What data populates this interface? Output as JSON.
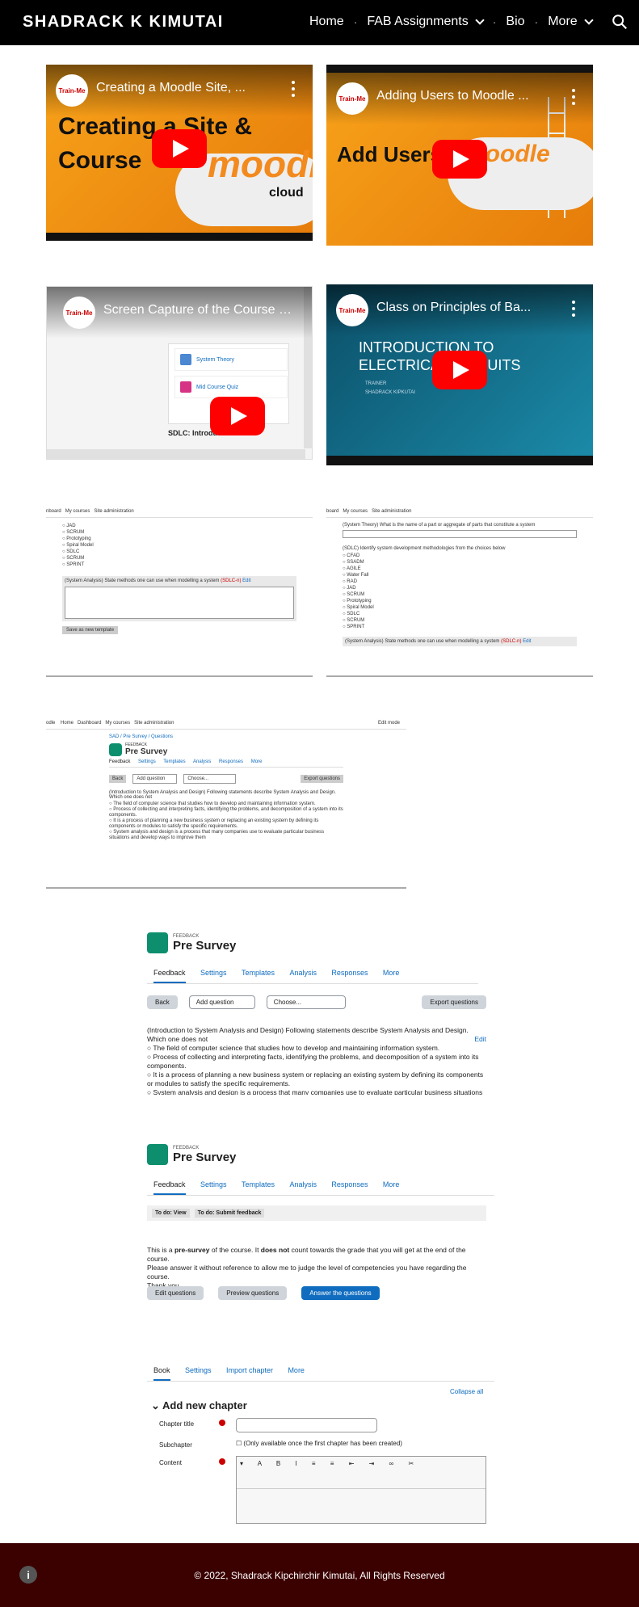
{
  "site": {
    "title": "SHADRACK K KIMUTAI"
  },
  "nav": {
    "items": [
      "Home",
      "FAB Assignments",
      "Bio",
      "More"
    ]
  },
  "videos": [
    {
      "title": "Creating a Moodle Site, ...",
      "overlay1": "Creating a Site &",
      "overlay2": "Course",
      "brand": "moodle",
      "sub": "cloud",
      "channel": "Train-Me"
    },
    {
      "title": "Adding Users to Moodle ...",
      "overlay1": "Add Users",
      "brand": "moodle",
      "channel": "Train-Me"
    },
    {
      "title": "Screen Capture of the Course b...",
      "items": [
        "System Theory",
        "Mid Course Quiz",
        "SDLC: Introduction and"
      ],
      "channel": "Train-Me"
    },
    {
      "title": "Class on Principles of Ba...",
      "line1": "INTRODUCTION TO",
      "line2": "ELECTRICAL CIRCUITS",
      "trainer": "TRAINER",
      "name": "SHADRACK KIPKUTAI",
      "channel": "Train-Me"
    }
  ],
  "shot1": {
    "nav": [
      "nboard",
      "My courses",
      "Site administration"
    ],
    "options": [
      "JAD",
      "SCRUM",
      "Prototyping",
      "Spiral Model",
      "SDLC",
      "SCRUM",
      "SPRINT"
    ],
    "question": "(System Analysis) State methods one can use when modelling a system",
    "tag": "(SDLC-n)",
    "edit": "Edit",
    "button": "Save as new template"
  },
  "shot2": {
    "nav": [
      "board",
      "My courses",
      "Site administration"
    ],
    "q1": "(System Theory) What is the name of a part or aggregate of parts that constitute a system",
    "q2": "(SDLC) Identify system development methodologies from the choices below",
    "options": [
      "CFAD",
      "SSADM",
      "AGILE",
      "Water Fall",
      "RAD",
      "JAD",
      "SCRUM",
      "Prototyping",
      "Spiral Model",
      "SDLC",
      "SCRUM",
      "SPRINT"
    ],
    "q3": "(System Analysis) State methods one can use when modelling a system",
    "tag": "(SDLC-n)",
    "edit": "Edit"
  },
  "shot3": {
    "nav": [
      "odle",
      "Home",
      "Dashboard",
      "My courses",
      "Site administration"
    ],
    "edit_mode": "Edit mode",
    "breadcrumb": "SAD / Pre Survey / Questions",
    "label": "FEEDBACK",
    "title": "Pre Survey",
    "tabs": [
      "Feedback",
      "Settings",
      "Templates",
      "Analysis",
      "Responses",
      "More"
    ],
    "back": "Back",
    "add": "Add question",
    "choose": "Choose...",
    "export": "Export questions",
    "question": "(Introduction to System Analysis and Design) Following statements describe System Analysis and Design. Which one does not",
    "answers": [
      "The field of computer science that studies how to develop and maintaining information system.",
      "Process of collecting and interpreting facts, identifying the problems, and decomposition of a system into its components.",
      "It is a process of planning a new business system or replacing an existing system by defining its components or modules to satisfy the specific requirements.",
      "System analysis and design is a process that many companies use to evaluate particular business situations and develop ways to improve them"
    ]
  },
  "shot4": {
    "label": "FEEDBACK",
    "title": "Pre Survey",
    "tabs": [
      "Feedback",
      "Settings",
      "Templates",
      "Analysis",
      "Responses",
      "More"
    ],
    "back": "Back",
    "add": "Add question",
    "choose": "Choose...",
    "export": "Export questions",
    "question": "(Introduction to System Analysis and Design) Following statements describe System Analysis and Design. Which one does not",
    "edit": "Edit",
    "answers": [
      "The field of computer science that studies how to develop and maintaining information system.",
      "Process of collecting and interpreting facts, identifying the problems, and decomposition of a system into its components.",
      "It is a process of planning a new business system or replacing an existing system by defining its components or modules to satisfy the specific requirements.",
      "System analysis and design is a process that many companies use to evaluate particular business situations and"
    ]
  },
  "shot5": {
    "label": "FEEDBACK",
    "title": "Pre Survey",
    "tabs": [
      "Feedback",
      "Settings",
      "Templates",
      "Analysis",
      "Responses",
      "More"
    ],
    "todo1": "To do: View",
    "todo2": "To do: Submit feedback",
    "text_a": "This is a ",
    "text_b": "pre-survey",
    "text_c": " of the course. It ",
    "text_d": "does not",
    "text_e": " count towards the grade that you will get at the end of the course.",
    "text_f": "Please answer it without reference to allow me to judge the level of competencies you have regarding the course.",
    "text_g": "Thank you",
    "b1": "Edit questions",
    "b2": "Preview questions",
    "b3": "Answer the questions"
  },
  "shot6": {
    "tabs": [
      "Book",
      "Settings",
      "Import chapter",
      "More"
    ],
    "collapse": "Collapse all",
    "heading": "Add new chapter",
    "f1": "Chapter title",
    "f2": "Subchapter",
    "f2note": "(Only available once the first chapter has been created)",
    "f3": "Content"
  },
  "footer": {
    "text": "© 2022, Shadrack Kipchirchir Kimutai, All Rights Reserved"
  }
}
